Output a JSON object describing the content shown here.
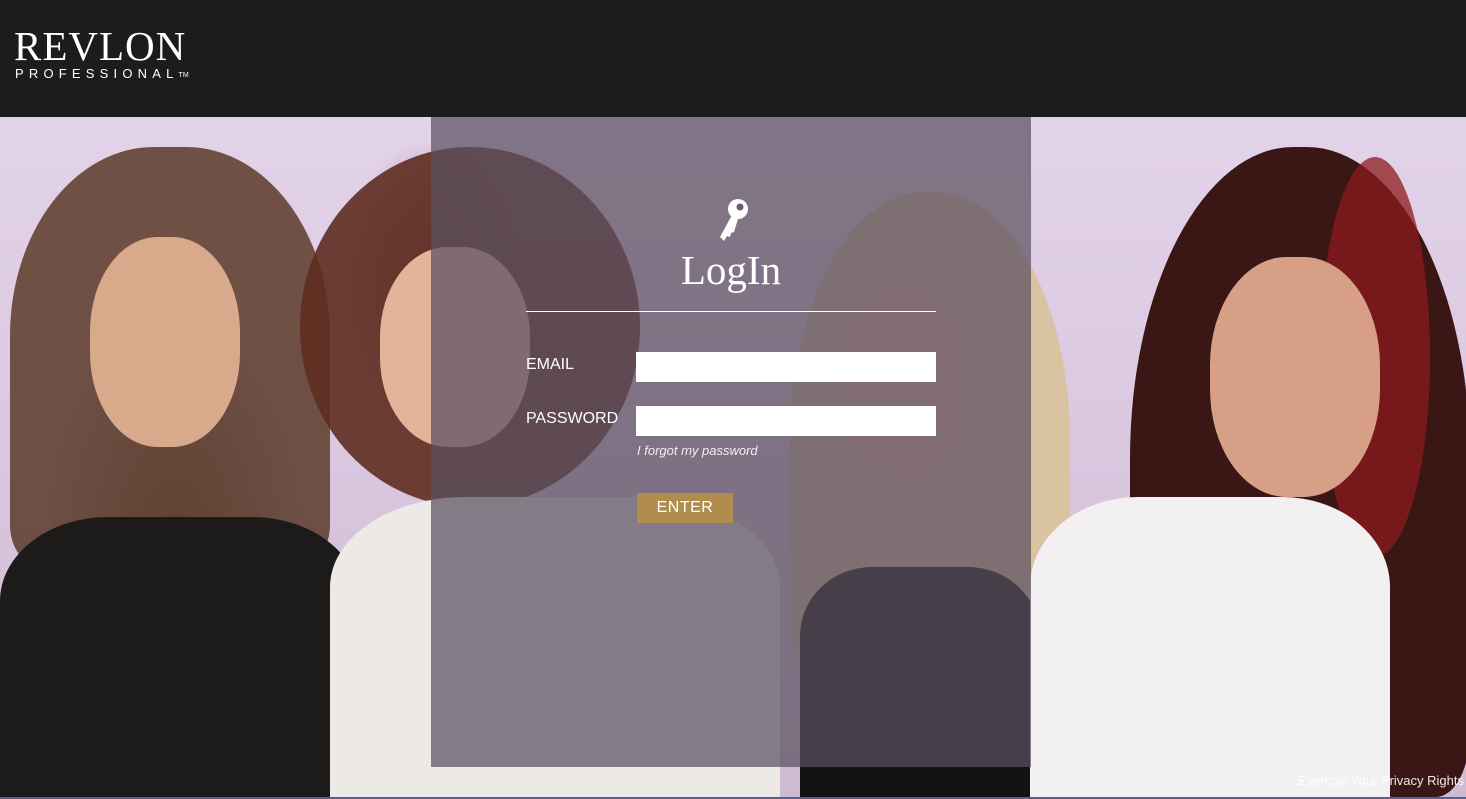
{
  "header": {
    "logo_main": "REVLON",
    "logo_sub": "PROFESSIONAL",
    "logo_tm": "TM"
  },
  "login": {
    "key_icon": "key-icon",
    "title": "LogIn",
    "email_label": "EMAIL",
    "email_value": "",
    "password_label": "PASSWORD",
    "password_value": "",
    "forgot_password": "I forgot my password",
    "enter_label": "ENTER"
  },
  "footer": {
    "privacy_link": "Exercise Your Privacy Rights"
  },
  "colors": {
    "header_bg": "#1c1c1c",
    "button_bg": "#b08d4c",
    "panel_overlay": "rgba(90, 80, 95, 0.72)",
    "hero_bg": "#e3d3e9"
  }
}
